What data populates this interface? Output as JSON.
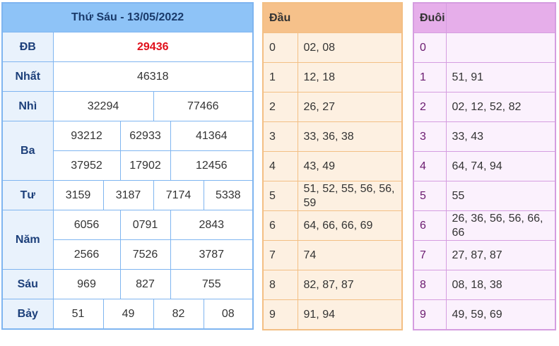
{
  "results": {
    "title": "Thứ Sáu - 13/05/2022",
    "rows": {
      "db": {
        "label": "ĐB",
        "values": [
          "29436"
        ]
      },
      "nhat": {
        "label": "Nhất",
        "values": [
          "46318"
        ]
      },
      "nhi": {
        "label": "Nhì",
        "values": [
          "32294",
          "77466"
        ]
      },
      "ba": {
        "label": "Ba",
        "values": [
          "93212",
          "62933",
          "41364",
          "37952",
          "17902",
          "12456"
        ]
      },
      "tu": {
        "label": "Tư",
        "values": [
          "3159",
          "3187",
          "7174",
          "5338"
        ]
      },
      "nam": {
        "label": "Năm",
        "values": [
          "6056",
          "0791",
          "2843",
          "2566",
          "7526",
          "3787"
        ]
      },
      "sau": {
        "label": "Sáu",
        "values": [
          "969",
          "827",
          "755"
        ]
      },
      "bay": {
        "label": "Bảy",
        "values": [
          "51",
          "49",
          "82",
          "08"
        ]
      }
    },
    "colors": {
      "header": "#8ec3f7",
      "border": "#7fb5f0",
      "special": "#e0101b"
    }
  },
  "dau": {
    "title": "Đầu",
    "rows": [
      {
        "key": "0",
        "value": "02, 08"
      },
      {
        "key": "1",
        "value": "12, 18"
      },
      {
        "key": "2",
        "value": "26, 27"
      },
      {
        "key": "3",
        "value": "33, 36, 38"
      },
      {
        "key": "4",
        "value": "43, 49"
      },
      {
        "key": "5",
        "value": "51, 52, 55, 56, 56, 59"
      },
      {
        "key": "6",
        "value": "64, 66, 66, 69"
      },
      {
        "key": "7",
        "value": "74"
      },
      {
        "key": "8",
        "value": "82, 87, 87"
      },
      {
        "key": "9",
        "value": "91, 94"
      }
    ]
  },
  "duoi": {
    "title": "Đuôi",
    "rows": [
      {
        "key": "0",
        "value": ""
      },
      {
        "key": "1",
        "value": "51, 91"
      },
      {
        "key": "2",
        "value": "02, 12, 52, 82"
      },
      {
        "key": "3",
        "value": "33, 43"
      },
      {
        "key": "4",
        "value": "64, 74, 94"
      },
      {
        "key": "5",
        "value": "55"
      },
      {
        "key": "6",
        "value": "26, 36, 56, 56, 66, 66"
      },
      {
        "key": "7",
        "value": "27, 87, 87"
      },
      {
        "key": "8",
        "value": "08, 18, 38"
      },
      {
        "key": "9",
        "value": "49, 59, 69"
      }
    ]
  }
}
